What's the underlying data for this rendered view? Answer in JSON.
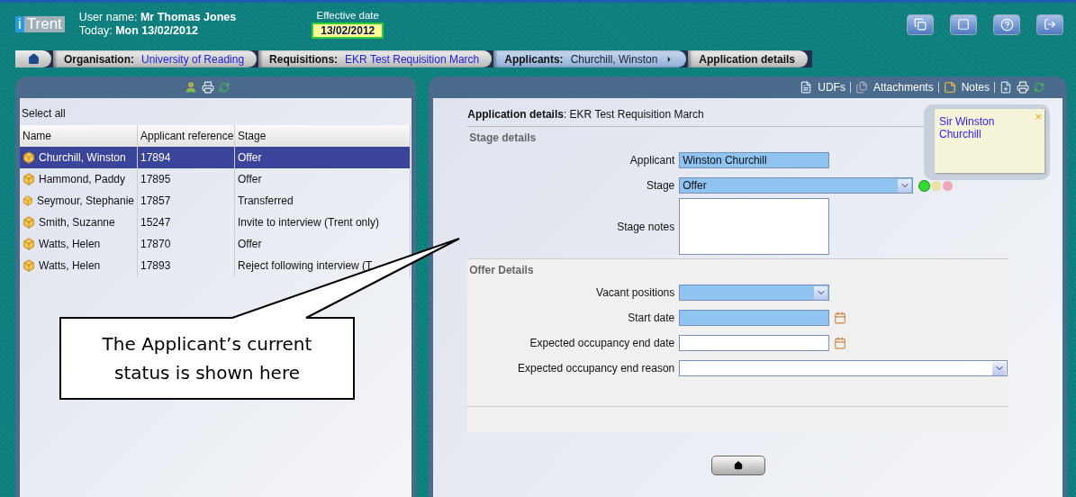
{
  "app": {
    "logo_mark": "i",
    "logo_text": "Trent",
    "user_line": "User name: **Mr Thomas Jones**",
    "today_line": "Today: **Mon 13/02/2012**",
    "effective_date_label": "Effective date",
    "effective_date": "13/02/2012"
  },
  "breadcrumb": [
    {
      "kind": "trail",
      "label": "Organisation:",
      "value": "University of Reading"
    },
    {
      "kind": "trail",
      "label": "Requisitions:",
      "value": "EKR Test Requisition March"
    },
    {
      "kind": "chooser",
      "label": "Applicants:",
      "value": "Churchill, Winston"
    },
    {
      "kind": "current",
      "label": "Application details"
    }
  ],
  "applicants_panel": {
    "select_all": "Select all",
    "columns": [
      "Name",
      "Applicant reference",
      "Stage"
    ],
    "rows": [
      {
        "name": "Churchill, Winston",
        "reference": "17894",
        "stage": "Offer",
        "selected": true
      },
      {
        "name": "Hammond, Paddy",
        "reference": "17895",
        "stage": "Offer",
        "selected": false
      },
      {
        "name": "Seymour, Stephanie",
        "reference": "17857",
        "stage": "Transferred",
        "selected": false
      },
      {
        "name": "Smith, Suzanne",
        "reference": "15247",
        "stage": "Invite to interview (Trent only)",
        "selected": false
      },
      {
        "name": "Watts, Helen",
        "reference": "17870",
        "stage": "Offer",
        "selected": false
      },
      {
        "name": "Watts, Helen",
        "reference": "17893",
        "stage": "Reject following interview (T",
        "selected": false
      }
    ]
  },
  "details_panel": {
    "toolbar": [
      {
        "kind": "udfs",
        "label": "UDFs"
      },
      {
        "kind": "attachments",
        "label": "Attachments"
      },
      {
        "kind": "notes",
        "label": "Notes"
      }
    ],
    "title": "**Application details**: EKR Test Requisition March",
    "sections": [
      {
        "heading": "Stage details",
        "fields": [
          {
            "kind": "text",
            "label": "Applicant",
            "value": "Winston Churchill",
            "required": true,
            "wide": false
          },
          {
            "kind": "select",
            "label": "Stage",
            "value": "Offer",
            "required": true,
            "wide": true,
            "status_lights": [
              {
                "color": "#33dd33",
                "selected": true
              },
              {
                "color": "#e8e2a4",
                "selected": false
              },
              {
                "color": "#f0a8b8",
                "selected": false
              }
            ]
          },
          {
            "kind": "textarea",
            "label": "Stage notes",
            "required": false,
            "wide": false
          }
        ]
      },
      {
        "heading": "Offer Details",
        "fields": [
          {
            "kind": "select",
            "label": "Vacant positions",
            "required": true,
            "wide": false
          },
          {
            "kind": "date",
            "label": "Start date",
            "required": true,
            "wide": false
          },
          {
            "kind": "date",
            "label": "Expected occupancy end date",
            "required": false,
            "wide": false
          },
          {
            "kind": "select",
            "label": "Expected occupancy end reason",
            "required": false,
            "wide": true
          }
        ]
      }
    ],
    "note": {
      "text": "Sir Winston Churchill",
      "close": "×"
    }
  },
  "callout": {
    "text": "The Applicant’s current status is shown here"
  }
}
